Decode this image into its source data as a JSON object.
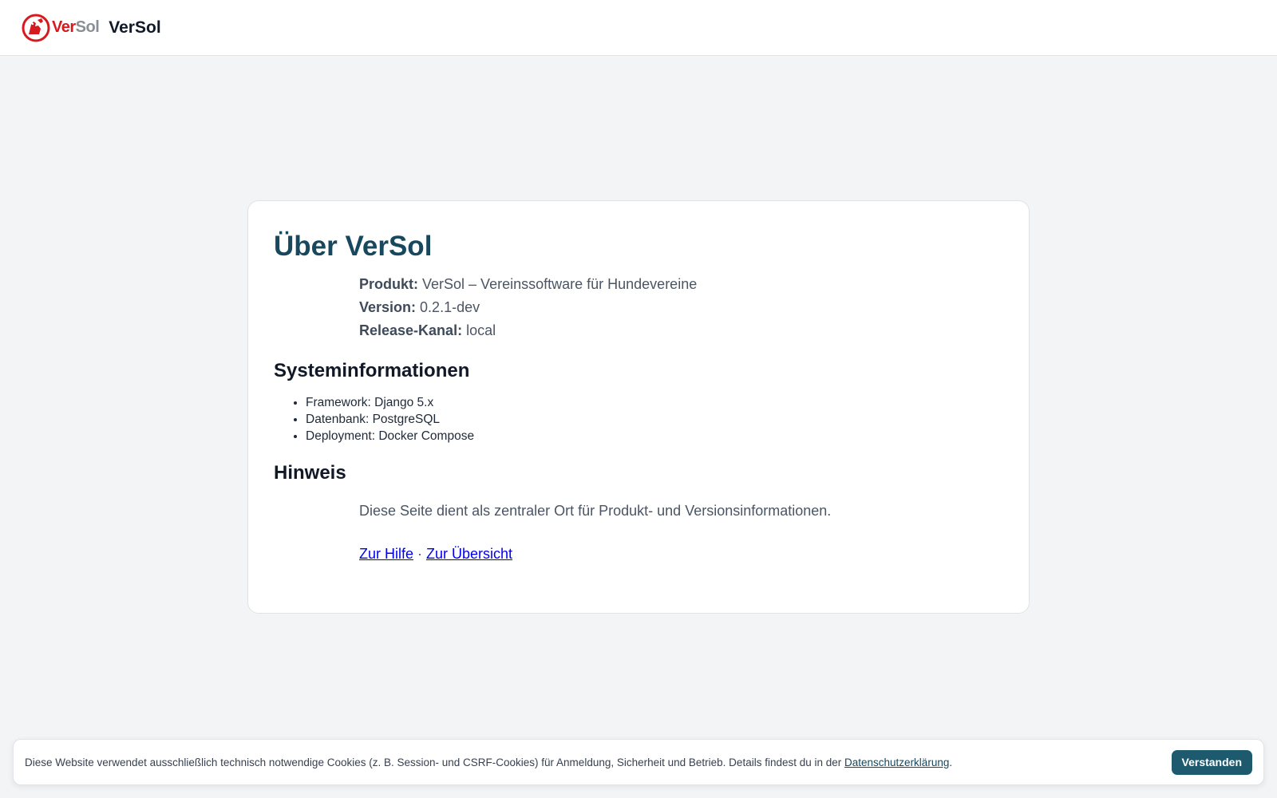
{
  "header": {
    "logo_ver": "Ver",
    "logo_sol": "Sol",
    "brand_name": "VerSol"
  },
  "main": {
    "title": "Über VerSol",
    "info": [
      {
        "key": "Produkt:",
        "value": "VerSol – Vereinssoftware für Hundevereine"
      },
      {
        "key": "Version:",
        "value": "0.2.1-dev"
      },
      {
        "key": "Release-Kanal:",
        "value": "local"
      }
    ],
    "system_heading": "Systeminformationen",
    "system_items": [
      "Framework: Django 5.x",
      "Datenbank: PostgreSQL",
      "Deployment: Docker Compose"
    ],
    "hint_heading": "Hinweis",
    "hint_text": "Diese Seite dient als zentraler Ort für Produkt- und Versionsinformationen.",
    "links": {
      "help": "Zur Hilfe",
      "separator": " · ",
      "overview": "Zur Übersicht"
    }
  },
  "cookie_banner": {
    "text": "Diese Website verwendet ausschließlich technisch notwendige Cookies (z. B. Session- und CSRF-Cookies) für Anmeldung, Sicherheit und Betrieb. Details findest du in der ",
    "privacy_link": "Datenschutzerklärung",
    "text_end": ".",
    "accept_button": "Verstanden"
  },
  "colors": {
    "brand_red": "#d71920",
    "title_teal": "#17485e",
    "button_teal": "#1d5a6e",
    "link_blue": "#0000ee"
  }
}
